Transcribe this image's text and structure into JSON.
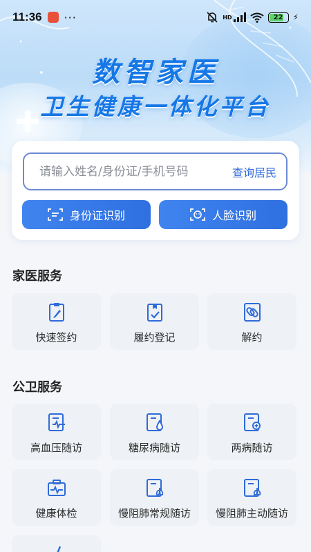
{
  "status_bar": {
    "time": "11:36",
    "more": "···",
    "network": "HD",
    "battery": "22"
  },
  "banner": {
    "title_line1": "数智家医",
    "title_line2": "卫生健康一体化平台"
  },
  "search": {
    "placeholder": "请输入姓名/身份证/手机号码",
    "query_label": "查询居民",
    "id_card_button": "身份证识别",
    "face_button": "人脸识别"
  },
  "family_services": {
    "title": "家医服务",
    "items": [
      {
        "label": "快速签约",
        "icon": "clipboard-pen-icon"
      },
      {
        "label": "履约登记",
        "icon": "clipboard-check-icon"
      },
      {
        "label": "解约",
        "icon": "document-broken-link-icon"
      }
    ]
  },
  "public_services": {
    "title": "公卫服务",
    "items": [
      {
        "label": "高血压随访",
        "icon": "heartbeat-doc-icon"
      },
      {
        "label": "糖尿病随访",
        "icon": "drop-doc-icon"
      },
      {
        "label": "两病随访",
        "icon": "plus-doc-icon"
      },
      {
        "label": "健康体检",
        "icon": "medical-kit-icon"
      },
      {
        "label": "慢阻肺常规随访",
        "icon": "lungs-doc-icon"
      },
      {
        "label": "慢阻肺主动随访",
        "icon": "lungs-doc-icon"
      }
    ]
  },
  "colors": {
    "primary": "#2f6bd8",
    "title_blue": "#1677e6",
    "tile_bg": "#eef1f6",
    "page_bg": "#f4f6fa"
  }
}
